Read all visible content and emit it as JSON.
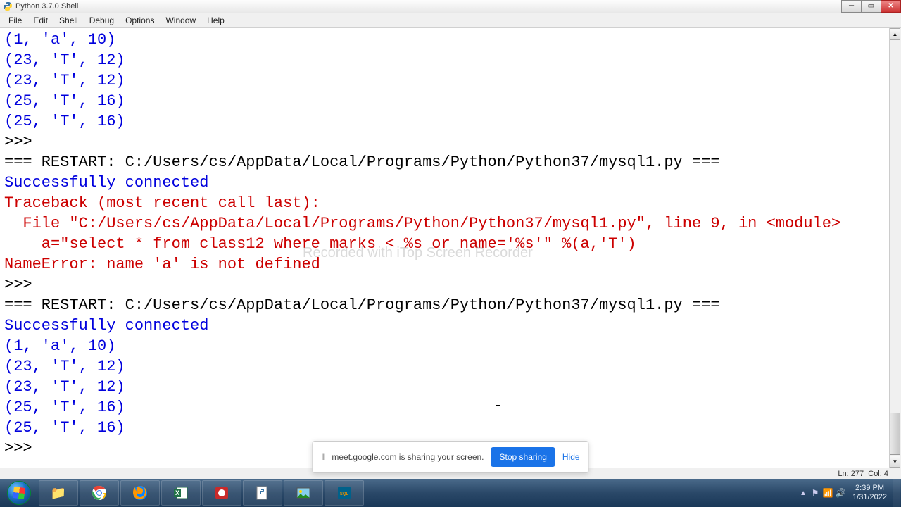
{
  "window": {
    "title": "Python 3.7.0 Shell"
  },
  "menu": {
    "file": "File",
    "edit": "Edit",
    "shell": "Shell",
    "debug": "Debug",
    "options": "Options",
    "window": "Window",
    "help": "Help"
  },
  "shell": {
    "line_partial": "(1, 'a', 10)",
    "tuple1": "(23, 'T', 12)",
    "tuple2": "(23, 'T', 12)",
    "tuple3": "(25, 'T', 16)",
    "tuple4": "(25, 'T', 16)",
    "prompt": ">>> ",
    "restart1": "=== RESTART: C:/Users/cs/AppData/Local/Programs/Python/Python37/mysql1.py ===",
    "success": "Successfully connected",
    "traceback": "Traceback (most recent call last):",
    "file_line": "  File \"C:/Users/cs/AppData/Local/Programs/Python/Python37/mysql1.py\", line 9, in <module>",
    "code_line": "    a=\"select * from class12 where marks < %s or name='%s'\" %(a,'T')",
    "error": "NameError: name 'a' is not defined",
    "restart2": "=== RESTART: C:/Users/cs/AppData/Local/Programs/Python/Python37/mysql1.py ===",
    "out1": "(1, 'a', 10)",
    "out2": "(23, 'T', 12)",
    "out3": "(23, 'T', 12)",
    "out4": "(25, 'T', 16)",
    "out5": "(25, 'T', 16)"
  },
  "status": {
    "ln_label": "Ln:",
    "ln": "277",
    "col_label": "Col:",
    "col": "4"
  },
  "watermark": "Recorded with iTop Screen Recorder",
  "share": {
    "text": "meet.google.com is sharing your screen.",
    "stop": "Stop sharing",
    "hide": "Hide"
  },
  "clock": {
    "time": "2:39 PM",
    "date": "1/31/2022"
  }
}
